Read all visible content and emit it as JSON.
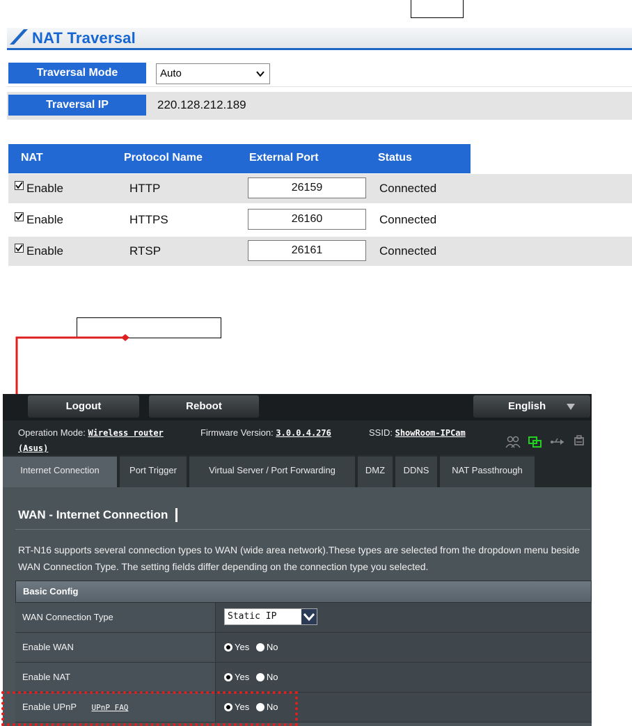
{
  "nat": {
    "title": "NAT Traversal",
    "mode_label": "Traversal Mode",
    "mode_value": "Auto",
    "ip_label": "Traversal IP",
    "ip_value": "220.128.212.189",
    "headers": [
      "NAT",
      "Protocol Name",
      "External Port",
      "Status"
    ],
    "rows": [
      {
        "enable": "Enable",
        "protocol": "HTTP",
        "port": "26159",
        "status": "Connected"
      },
      {
        "enable": "Enable",
        "protocol": "HTTPS",
        "port": "26160",
        "status": "Connected"
      },
      {
        "enable": "Enable",
        "protocol": "RTSP",
        "port": "26161",
        "status": "Connected"
      }
    ]
  },
  "router": {
    "logout": "Logout",
    "reboot": "Reboot",
    "language": "English",
    "op_mode_label": "Operation Mode:",
    "op_mode_value": "Wireless router",
    "firmware_label": "Firmware Version:",
    "firmware_value": "3.0.0.4.276",
    "ssid_label": "SSID:",
    "ssid_value": "ShowRoom-IPCam",
    "asus_link": "(Asus)",
    "tabs": [
      "Internet Connection",
      "Port Trigger",
      "Virtual Server / Port Forwarding",
      "DMZ",
      "DDNS",
      "NAT Passthrough"
    ],
    "page_title": "WAN - Internet Connection",
    "description": "RT-N16 supports several connection types to WAN (wide area network).These types are selected from the dropdown menu beside WAN Connection Type. The setting fields differ depending on the connection type you selected.",
    "section_title": "Basic Config",
    "rows": {
      "wan_type_label": "WAN Connection Type",
      "wan_type_value": "Static IP",
      "enable_wan_label": "Enable WAN",
      "enable_nat_label": "Enable NAT",
      "enable_upnp_label": "Enable UPnP",
      "upnp_faq": "UPnP FAQ",
      "yes": "Yes",
      "no": "No"
    }
  }
}
